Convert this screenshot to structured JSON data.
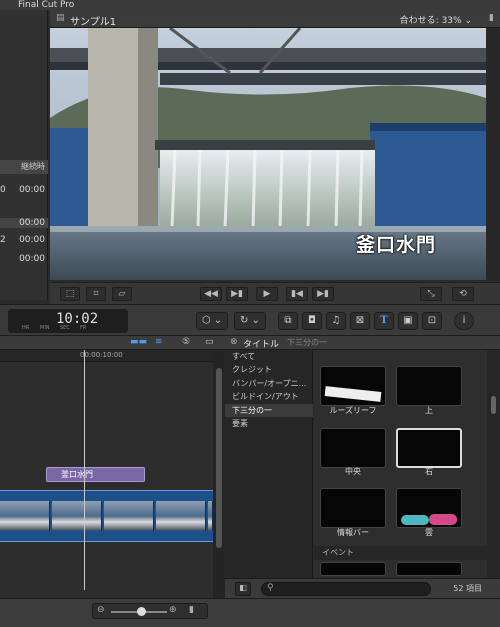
{
  "app_title": "Final Cut Pro",
  "viewer": {
    "project_name": "サンプル1",
    "fit_label": "合わせる:",
    "zoom": "33%",
    "caption": "釜口水門"
  },
  "left_panel": {
    "column_header": "継続時",
    "rows": [
      {
        "left": "0",
        "right": "00:00"
      },
      {
        "left": "8",
        "right": "00:00"
      },
      {
        "left": "2",
        "right": "00:00"
      },
      {
        "left": "",
        "right": "00:00"
      }
    ]
  },
  "timecode": {
    "value": "10:02",
    "units": [
      "HR",
      "MIN",
      "SEC",
      "FR"
    ]
  },
  "timeline": {
    "ruler_mark": "00:00:10:00",
    "title_clip": "釜口水門"
  },
  "browser": {
    "title": "タイトル",
    "subtitle": "下三分の一",
    "categories": [
      {
        "label": "すべて",
        "selected": false
      },
      {
        "label": "クレジット",
        "selected": false
      },
      {
        "label": "バンパー/オープニ...",
        "selected": false
      },
      {
        "label": "ビルドイン/アウト",
        "selected": false
      },
      {
        "label": "下三分の一",
        "selected": true
      },
      {
        "label": "要素",
        "selected": false
      }
    ],
    "tiles": [
      {
        "label": "ルーズリーフ"
      },
      {
        "label": "上"
      },
      {
        "label": "中央"
      },
      {
        "label": "右"
      },
      {
        "label": "情報バー"
      },
      {
        "label": "雲"
      }
    ],
    "section_label": "イベント",
    "item_count": "52 項目"
  },
  "colors": {
    "accent_blue": "#4f9cf5",
    "title_clip": "#7a68a6",
    "video_clip": "#1d4f8a"
  }
}
